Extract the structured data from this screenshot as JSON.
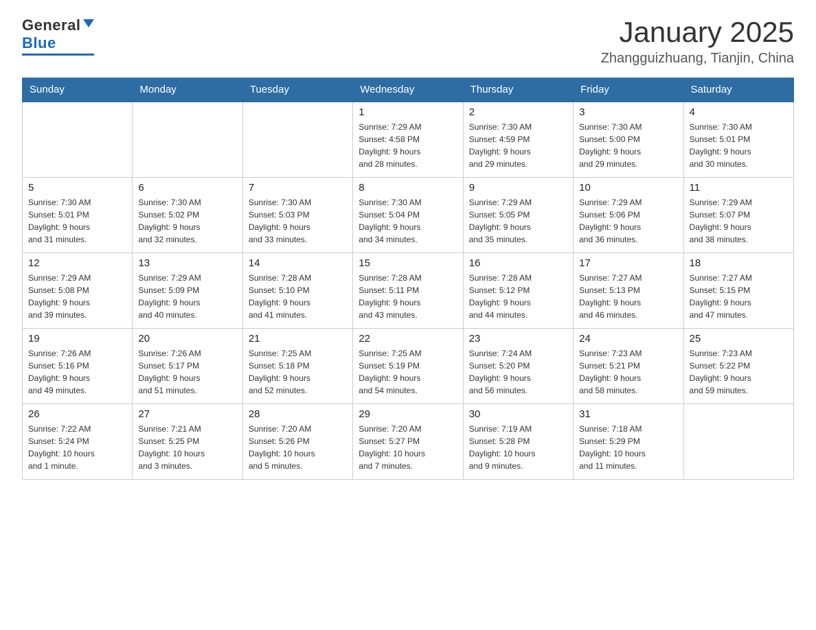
{
  "logo": {
    "general": "General",
    "blue": "Blue"
  },
  "title": "January 2025",
  "subtitle": "Zhangguizhuang, Tianjin, China",
  "days_of_week": [
    "Sunday",
    "Monday",
    "Tuesday",
    "Wednesday",
    "Thursday",
    "Friday",
    "Saturday"
  ],
  "weeks": [
    [
      {
        "day": "",
        "info": ""
      },
      {
        "day": "",
        "info": ""
      },
      {
        "day": "",
        "info": ""
      },
      {
        "day": "1",
        "info": "Sunrise: 7:29 AM\nSunset: 4:58 PM\nDaylight: 9 hours\nand 28 minutes."
      },
      {
        "day": "2",
        "info": "Sunrise: 7:30 AM\nSunset: 4:59 PM\nDaylight: 9 hours\nand 29 minutes."
      },
      {
        "day": "3",
        "info": "Sunrise: 7:30 AM\nSunset: 5:00 PM\nDaylight: 9 hours\nand 29 minutes."
      },
      {
        "day": "4",
        "info": "Sunrise: 7:30 AM\nSunset: 5:01 PM\nDaylight: 9 hours\nand 30 minutes."
      }
    ],
    [
      {
        "day": "5",
        "info": "Sunrise: 7:30 AM\nSunset: 5:01 PM\nDaylight: 9 hours\nand 31 minutes."
      },
      {
        "day": "6",
        "info": "Sunrise: 7:30 AM\nSunset: 5:02 PM\nDaylight: 9 hours\nand 32 minutes."
      },
      {
        "day": "7",
        "info": "Sunrise: 7:30 AM\nSunset: 5:03 PM\nDaylight: 9 hours\nand 33 minutes."
      },
      {
        "day": "8",
        "info": "Sunrise: 7:30 AM\nSunset: 5:04 PM\nDaylight: 9 hours\nand 34 minutes."
      },
      {
        "day": "9",
        "info": "Sunrise: 7:29 AM\nSunset: 5:05 PM\nDaylight: 9 hours\nand 35 minutes."
      },
      {
        "day": "10",
        "info": "Sunrise: 7:29 AM\nSunset: 5:06 PM\nDaylight: 9 hours\nand 36 minutes."
      },
      {
        "day": "11",
        "info": "Sunrise: 7:29 AM\nSunset: 5:07 PM\nDaylight: 9 hours\nand 38 minutes."
      }
    ],
    [
      {
        "day": "12",
        "info": "Sunrise: 7:29 AM\nSunset: 5:08 PM\nDaylight: 9 hours\nand 39 minutes."
      },
      {
        "day": "13",
        "info": "Sunrise: 7:29 AM\nSunset: 5:09 PM\nDaylight: 9 hours\nand 40 minutes."
      },
      {
        "day": "14",
        "info": "Sunrise: 7:28 AM\nSunset: 5:10 PM\nDaylight: 9 hours\nand 41 minutes."
      },
      {
        "day": "15",
        "info": "Sunrise: 7:28 AM\nSunset: 5:11 PM\nDaylight: 9 hours\nand 43 minutes."
      },
      {
        "day": "16",
        "info": "Sunrise: 7:28 AM\nSunset: 5:12 PM\nDaylight: 9 hours\nand 44 minutes."
      },
      {
        "day": "17",
        "info": "Sunrise: 7:27 AM\nSunset: 5:13 PM\nDaylight: 9 hours\nand 46 minutes."
      },
      {
        "day": "18",
        "info": "Sunrise: 7:27 AM\nSunset: 5:15 PM\nDaylight: 9 hours\nand 47 minutes."
      }
    ],
    [
      {
        "day": "19",
        "info": "Sunrise: 7:26 AM\nSunset: 5:16 PM\nDaylight: 9 hours\nand 49 minutes."
      },
      {
        "day": "20",
        "info": "Sunrise: 7:26 AM\nSunset: 5:17 PM\nDaylight: 9 hours\nand 51 minutes."
      },
      {
        "day": "21",
        "info": "Sunrise: 7:25 AM\nSunset: 5:18 PM\nDaylight: 9 hours\nand 52 minutes."
      },
      {
        "day": "22",
        "info": "Sunrise: 7:25 AM\nSunset: 5:19 PM\nDaylight: 9 hours\nand 54 minutes."
      },
      {
        "day": "23",
        "info": "Sunrise: 7:24 AM\nSunset: 5:20 PM\nDaylight: 9 hours\nand 56 minutes."
      },
      {
        "day": "24",
        "info": "Sunrise: 7:23 AM\nSunset: 5:21 PM\nDaylight: 9 hours\nand 58 minutes."
      },
      {
        "day": "25",
        "info": "Sunrise: 7:23 AM\nSunset: 5:22 PM\nDaylight: 9 hours\nand 59 minutes."
      }
    ],
    [
      {
        "day": "26",
        "info": "Sunrise: 7:22 AM\nSunset: 5:24 PM\nDaylight: 10 hours\nand 1 minute."
      },
      {
        "day": "27",
        "info": "Sunrise: 7:21 AM\nSunset: 5:25 PM\nDaylight: 10 hours\nand 3 minutes."
      },
      {
        "day": "28",
        "info": "Sunrise: 7:20 AM\nSunset: 5:26 PM\nDaylight: 10 hours\nand 5 minutes."
      },
      {
        "day": "29",
        "info": "Sunrise: 7:20 AM\nSunset: 5:27 PM\nDaylight: 10 hours\nand 7 minutes."
      },
      {
        "day": "30",
        "info": "Sunrise: 7:19 AM\nSunset: 5:28 PM\nDaylight: 10 hours\nand 9 minutes."
      },
      {
        "day": "31",
        "info": "Sunrise: 7:18 AM\nSunset: 5:29 PM\nDaylight: 10 hours\nand 11 minutes."
      },
      {
        "day": "",
        "info": ""
      }
    ]
  ]
}
